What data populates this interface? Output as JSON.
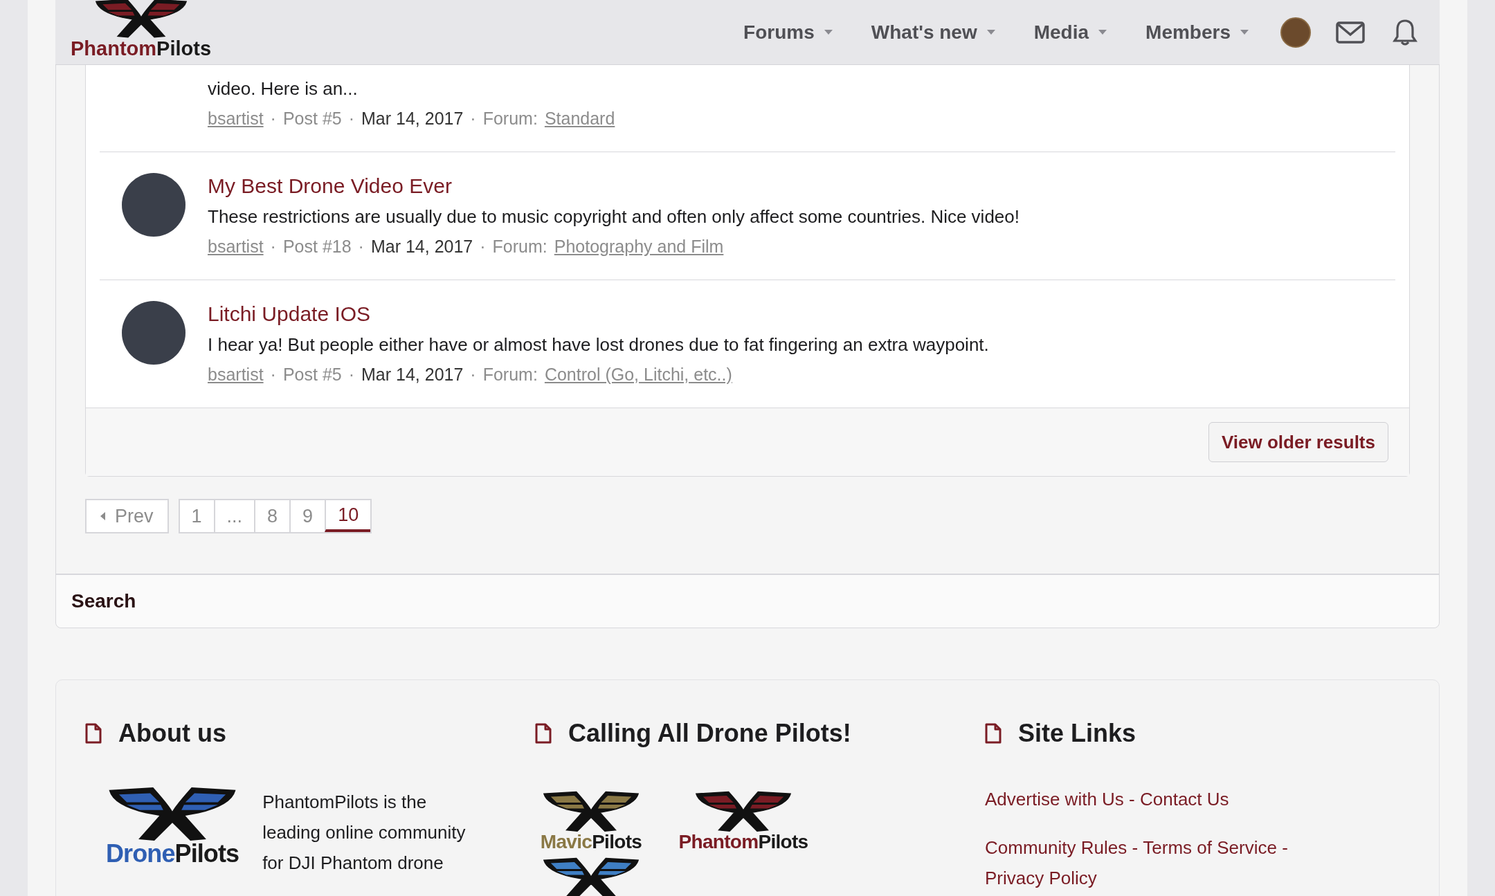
{
  "header": {
    "logo": {
      "first": "Phantom",
      "second": "Pilots"
    },
    "nav": [
      {
        "label": "Forums"
      },
      {
        "label": "What's new"
      },
      {
        "label": "Media"
      },
      {
        "label": "Members"
      }
    ]
  },
  "results": [
    {
      "snippet": "video. Here is an...",
      "author": "bsartist",
      "post": "Post #5",
      "date": "Mar 14, 2017",
      "forum_label": "Forum:",
      "forum": "Standard"
    },
    {
      "title": "My Best Drone Video Ever",
      "snippet": "These restrictions are usually due to music copyright and often only affect some countries. Nice video!",
      "author": "bsartist",
      "post": "Post #18",
      "date": "Mar 14, 2017",
      "forum_label": "Forum:",
      "forum": "Photography and Film"
    },
    {
      "title": "Litchi Update IOS",
      "snippet": "I hear ya! But people either have or almost have lost drones due to fat fingering an extra waypoint.",
      "author": "bsartist",
      "post": "Post #5",
      "date": "Mar 14, 2017",
      "forum_label": "Forum:",
      "forum": "Control (Go, Litchi, etc..)"
    }
  ],
  "meta_separator": "·",
  "load_more": "View older results",
  "pagination": {
    "prev": "Prev",
    "pages": [
      {
        "label": "1",
        "selected": false
      },
      {
        "label": "...",
        "selected": false
      },
      {
        "label": "8",
        "selected": false
      },
      {
        "label": "9",
        "selected": false
      },
      {
        "label": "10",
        "selected": true
      }
    ]
  },
  "search_title": "Search",
  "footer": {
    "about": {
      "title": "About us",
      "logo": {
        "first": "Drone",
        "second": "Pilots",
        "color": "#2f5fb3"
      },
      "text": "PhantomPilots is the leading online community for DJI Phantom drone"
    },
    "calling": {
      "title": "Calling All Drone Pilots!",
      "logos": [
        {
          "first": "Mavic",
          "second": "Pilots",
          "color": "#8a7845"
        },
        {
          "first": "Phantom",
          "second": "Pilots",
          "color": "#7a1c24"
        },
        {
          "color": "#3f7fc4"
        }
      ]
    },
    "links": {
      "title": "Site Links",
      "separator": "-",
      "rows": [
        [
          "Advertise with Us",
          "Contact Us"
        ],
        [
          "Community Rules",
          "Terms of Service",
          "Privacy Policy"
        ]
      ]
    }
  }
}
